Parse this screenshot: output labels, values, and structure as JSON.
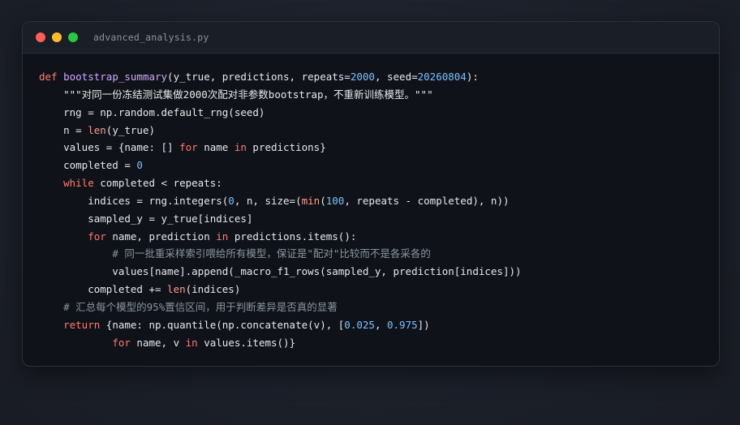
{
  "window": {
    "filename": "advanced_analysis.py"
  },
  "colors": {
    "keyword": "#ff7b72",
    "function": "#d2a8ff",
    "number": "#79c0ff",
    "comment": "#8b949e",
    "text": "#e6e8ea",
    "background": "#0f1319"
  },
  "code": {
    "lines": [
      [
        {
          "t": "kw",
          "v": "def "
        },
        {
          "t": "fn",
          "v": "bootstrap_summary"
        },
        {
          "t": "",
          "v": "(y_true, predictions, repeats="
        },
        {
          "t": "num",
          "v": "2000"
        },
        {
          "t": "",
          "v": ", seed="
        },
        {
          "t": "num",
          "v": "20260804"
        },
        {
          "t": "",
          "v": "):"
        }
      ],
      [
        {
          "t": "",
          "v": "    "
        },
        {
          "t": "str",
          "v": "\"\"\"对同一份冻结测试集做2000次配对非参数bootstrap，不重新训练模型。\"\"\""
        }
      ],
      [
        {
          "t": "",
          "v": "    rng = np.random.default_rng(seed)"
        }
      ],
      [
        {
          "t": "",
          "v": "    n = "
        },
        {
          "t": "bi",
          "v": "len"
        },
        {
          "t": "",
          "v": "(y_true)"
        }
      ],
      [
        {
          "t": "",
          "v": "    values = {name: [] "
        },
        {
          "t": "kw",
          "v": "for"
        },
        {
          "t": "",
          "v": " name "
        },
        {
          "t": "kw",
          "v": "in"
        },
        {
          "t": "",
          "v": " predictions}"
        }
      ],
      [
        {
          "t": "",
          "v": "    completed = "
        },
        {
          "t": "num",
          "v": "0"
        }
      ],
      [
        {
          "t": "",
          "v": "    "
        },
        {
          "t": "kw",
          "v": "while"
        },
        {
          "t": "",
          "v": " completed < repeats:"
        }
      ],
      [
        {
          "t": "",
          "v": "        indices = rng.integers("
        },
        {
          "t": "num",
          "v": "0"
        },
        {
          "t": "",
          "v": ", n, size=("
        },
        {
          "t": "bi",
          "v": "min"
        },
        {
          "t": "",
          "v": "("
        },
        {
          "t": "num",
          "v": "100"
        },
        {
          "t": "",
          "v": ", repeats - completed), n))"
        }
      ],
      [
        {
          "t": "",
          "v": "        sampled_y = y_true[indices]"
        }
      ],
      [
        {
          "t": "",
          "v": "        "
        },
        {
          "t": "kw",
          "v": "for"
        },
        {
          "t": "",
          "v": " name, prediction "
        },
        {
          "t": "kw",
          "v": "in"
        },
        {
          "t": "",
          "v": " predictions.items():"
        }
      ],
      [
        {
          "t": "",
          "v": "            "
        },
        {
          "t": "cm",
          "v": "# 同一批重采样索引喂给所有模型，保证是\"配对\"比较而不是各采各的"
        }
      ],
      [
        {
          "t": "",
          "v": "            values[name].append(_macro_f1_rows(sampled_y, prediction[indices]))"
        }
      ],
      [
        {
          "t": "",
          "v": "        completed += "
        },
        {
          "t": "bi",
          "v": "len"
        },
        {
          "t": "",
          "v": "(indices)"
        }
      ],
      [
        {
          "t": "",
          "v": "    "
        },
        {
          "t": "cm",
          "v": "# 汇总每个模型的95%置信区间，用于判断差异是否真的显著"
        }
      ],
      [
        {
          "t": "",
          "v": "    "
        },
        {
          "t": "kw",
          "v": "return"
        },
        {
          "t": "",
          "v": " {name: np.quantile(np.concatenate(v), ["
        },
        {
          "t": "num",
          "v": "0.025"
        },
        {
          "t": "",
          "v": ", "
        },
        {
          "t": "num",
          "v": "0.975"
        },
        {
          "t": "",
          "v": "])"
        }
      ],
      [
        {
          "t": "",
          "v": "            "
        },
        {
          "t": "kw",
          "v": "for"
        },
        {
          "t": "",
          "v": " name, v "
        },
        {
          "t": "kw",
          "v": "in"
        },
        {
          "t": "",
          "v": " values.items()}"
        }
      ]
    ]
  }
}
